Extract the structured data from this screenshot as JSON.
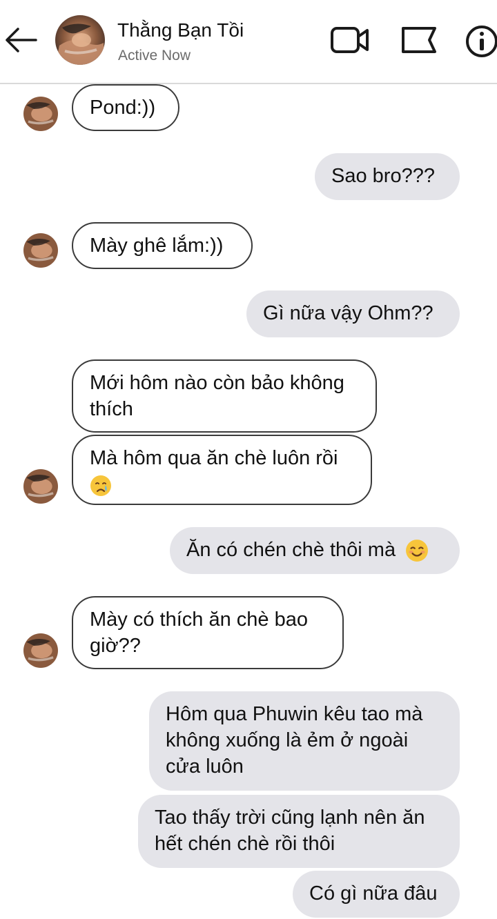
{
  "header": {
    "contact_name": "Thằng Bạn Tồi",
    "status": "Active Now"
  },
  "icons": {
    "back": "back-arrow-icon",
    "video": "video-camera-icon",
    "flag": "flag-icon",
    "info": "info-icon",
    "emoji_cry": "crying-face-emoji",
    "emoji_smile": "smiling-blush-emoji"
  },
  "colors": {
    "outgoing_bubble": "#e4e4e9",
    "incoming_border": "#3a3a3a",
    "divider": "#d9d9d9",
    "status_text": "#6b6b6b"
  },
  "messages": [
    {
      "side": "in",
      "lines": [
        "Pond:))"
      ]
    },
    {
      "side": "out",
      "lines": [
        "Sao bro???"
      ]
    },
    {
      "side": "in",
      "lines": [
        "Mày ghê lắm:))"
      ]
    },
    {
      "side": "out",
      "lines": [
        "Gì nữa vậy Ohm??"
      ]
    },
    {
      "side": "in",
      "lines": [
        "Mới hôm nào còn bảo không",
        "thích"
      ]
    },
    {
      "side": "in",
      "lines": [
        "Mà hôm qua ăn chè luôn rồi",
        ""
      ]
    },
    {
      "side": "out",
      "lines": [
        "Ăn có chén chè thôi mà"
      ]
    },
    {
      "side": "in",
      "lines": [
        "Mày có thích ăn chè bao",
        "giờ??"
      ]
    },
    {
      "side": "out",
      "lines": [
        "Hôm qua Phuwin kêu tao mà",
        "không xuống là ẻm ở ngoài",
        "cửa luôn"
      ]
    },
    {
      "side": "out",
      "lines": [
        "Tao thấy trời cũng lạnh nên ăn",
        "hết chén chè rồi thôi"
      ]
    },
    {
      "side": "out",
      "lines": [
        "Có gì nữa đâu"
      ]
    }
  ]
}
